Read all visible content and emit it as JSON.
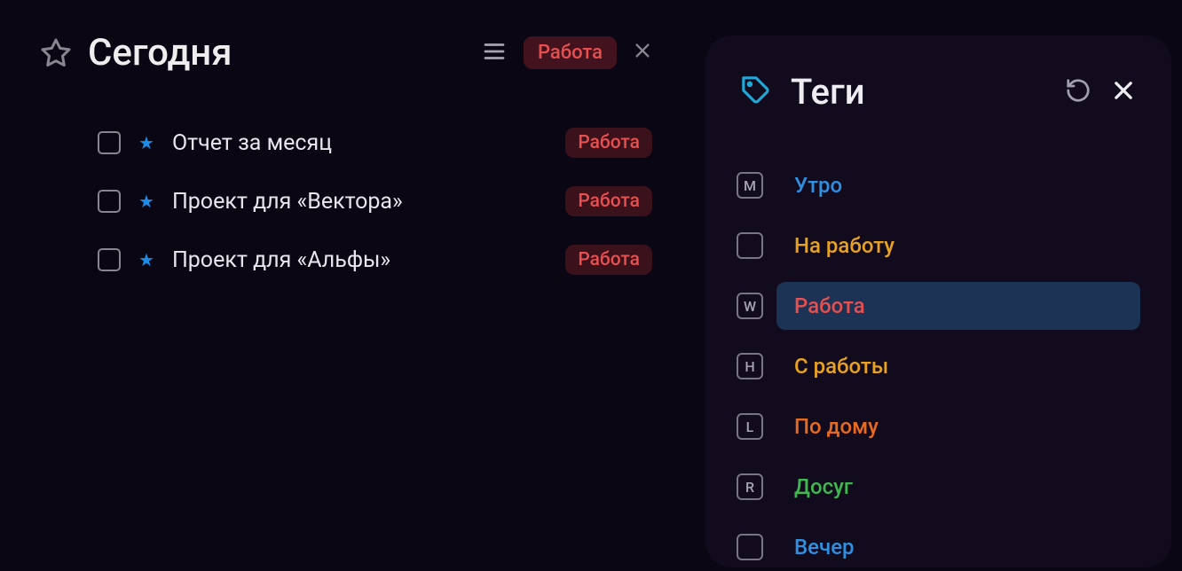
{
  "header": {
    "title": "Сегодня",
    "filter_tag": "Работа"
  },
  "tasks": [
    {
      "label": "Отчет за месяц",
      "tag": "Работа"
    },
    {
      "label": "Проект для «Вектора»",
      "tag": "Работа"
    },
    {
      "label": "Проект для «Альфы»",
      "tag": "Работа"
    }
  ],
  "side_panel": {
    "title": "Теги",
    "tags": [
      {
        "key": "M",
        "name": "Утро",
        "color": "#2f8fe0",
        "selected": false
      },
      {
        "key": "",
        "name": "На работу",
        "color": "#e8a220",
        "selected": false
      },
      {
        "key": "W",
        "name": "Работа",
        "color": "#e84f4f",
        "selected": true
      },
      {
        "key": "H",
        "name": "С работы",
        "color": "#e8a220",
        "selected": false
      },
      {
        "key": "L",
        "name": "По дому",
        "color": "#e86a20",
        "selected": false
      },
      {
        "key": "R",
        "name": "Досуг",
        "color": "#3fb850",
        "selected": false
      },
      {
        "key": "",
        "name": "Вечер",
        "color": "#2f8fe0",
        "selected": false
      }
    ]
  }
}
